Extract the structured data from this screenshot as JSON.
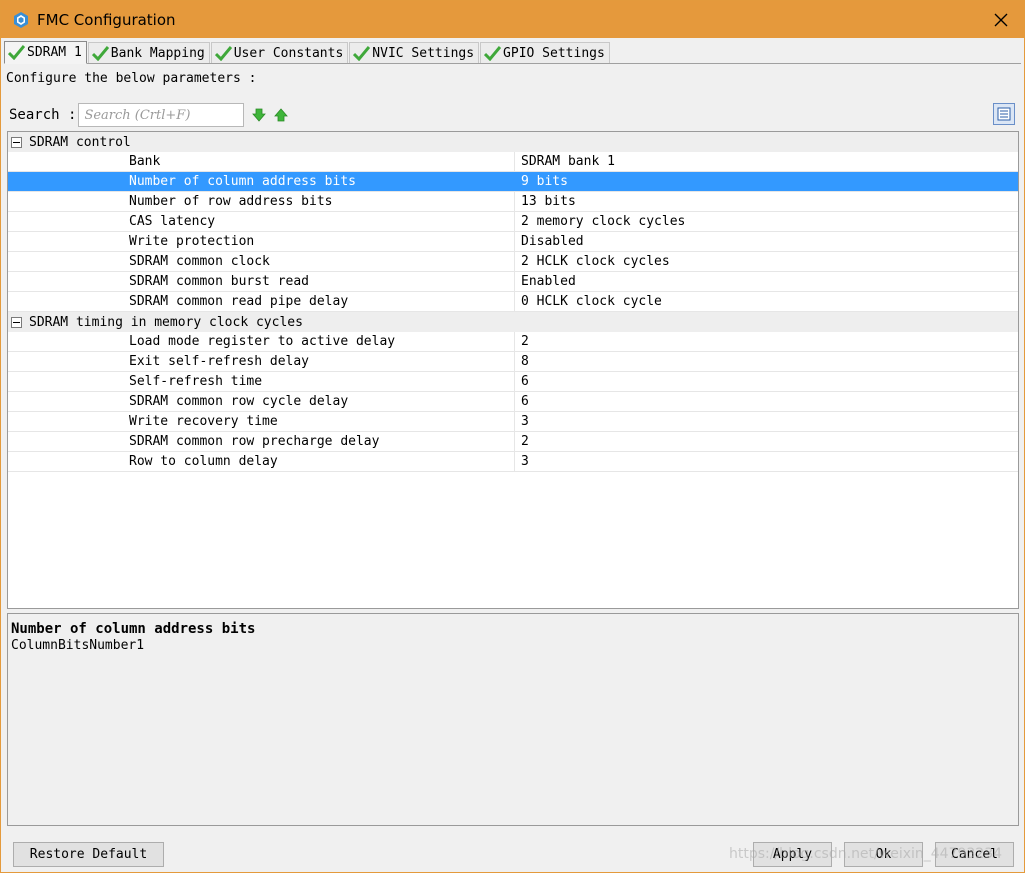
{
  "window": {
    "title": "FMC Configuration",
    "accent_color": "#e5993c"
  },
  "tabs": [
    {
      "label": "SDRAM 1",
      "active": true
    },
    {
      "label": "Bank Mapping",
      "active": false
    },
    {
      "label": "User Constants",
      "active": false
    },
    {
      "label": "NVIC Settings",
      "active": false
    },
    {
      "label": "GPIO Settings",
      "active": false
    }
  ],
  "configure_label": "Configure the below parameters :",
  "search": {
    "label": "Search :",
    "placeholder": "Search (Crtl+F)"
  },
  "groups": [
    {
      "label": "SDRAM control",
      "params": [
        {
          "name": "Bank",
          "value": "SDRAM bank 1"
        },
        {
          "name": "Number of column address bits",
          "value": "9 bits"
        },
        {
          "name": "Number of row address bits",
          "value": "13 bits"
        },
        {
          "name": "CAS latency",
          "value": "2 memory clock cycles"
        },
        {
          "name": "Write protection",
          "value": "Disabled"
        },
        {
          "name": "SDRAM common clock",
          "value": "2 HCLK clock cycles"
        },
        {
          "name": "SDRAM common burst read",
          "value": "Enabled"
        },
        {
          "name": "SDRAM common read pipe delay",
          "value": "0 HCLK clock cycle"
        }
      ]
    },
    {
      "label": "SDRAM timing in memory clock cycles",
      "params": [
        {
          "name": "Load mode register to active delay",
          "value": "2"
        },
        {
          "name": "Exit self-refresh delay",
          "value": "8"
        },
        {
          "name": "Self-refresh time",
          "value": "6"
        },
        {
          "name": "SDRAM common row cycle delay",
          "value": "6"
        },
        {
          "name": "Write recovery time",
          "value": "3"
        },
        {
          "name": "SDRAM common row precharge delay",
          "value": "2"
        },
        {
          "name": "Row to column delay",
          "value": "3"
        }
      ]
    }
  ],
  "selection_color": "#3399ff",
  "description": {
    "title": "Number of column address bits",
    "body": "ColumnBitsNumber1"
  },
  "buttons": {
    "restore_default": "Restore Default",
    "apply": "Apply",
    "ok": "Ok",
    "cancel": "Cancel"
  },
  "watermark": "https://blog.csdn.net/weixin_44793234"
}
